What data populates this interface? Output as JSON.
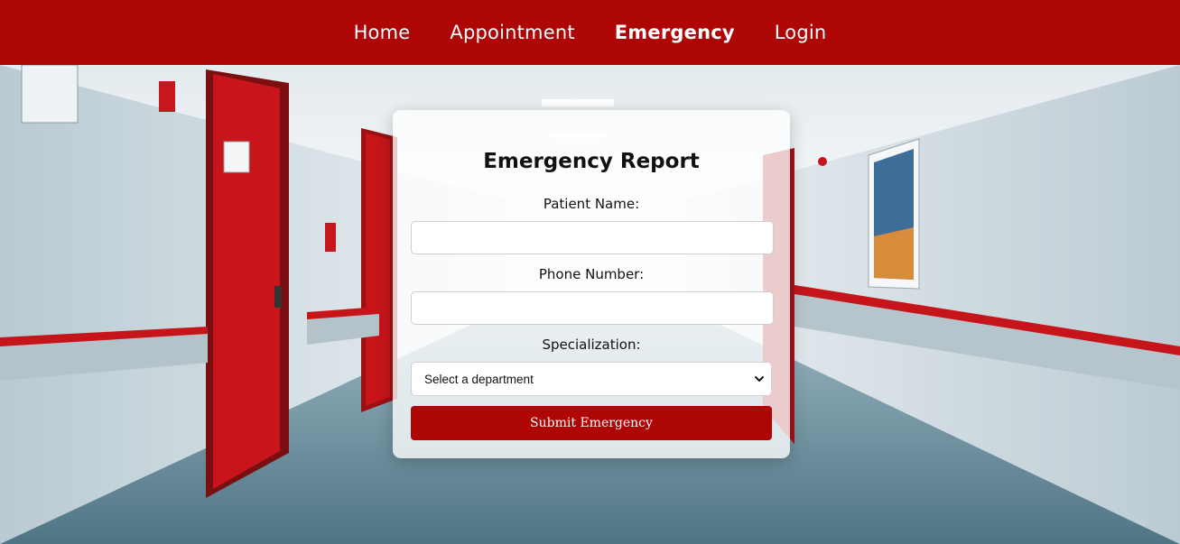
{
  "nav": {
    "items": [
      {
        "label": "Home",
        "active": false
      },
      {
        "label": "Appointment",
        "active": false
      },
      {
        "label": "Emergency",
        "active": true
      },
      {
        "label": "Login",
        "active": false
      }
    ]
  },
  "form": {
    "title": "Emergency Report",
    "patient_name_label": "Patient Name:",
    "patient_name_value": "",
    "phone_label": "Phone Number:",
    "phone_value": "",
    "specialization_label": "Specialization:",
    "specialization_selected": "Select a department",
    "submit_label": "Submit Emergency"
  },
  "colors": {
    "brand_red": "#ae0505",
    "card_bg": "rgba(255,255,255,0.78)"
  },
  "icons": {
    "select_arrow": "chevron-down-icon"
  }
}
